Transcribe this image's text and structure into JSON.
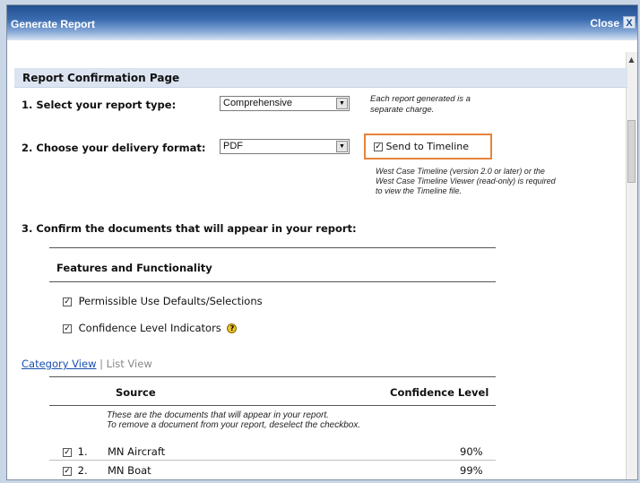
{
  "window": {
    "title": "Generate Report",
    "close_label": "Close",
    "close_icon_glyph": "X"
  },
  "section": {
    "title": "Report Confirmation Page"
  },
  "step1": {
    "label": "1. Select your report type:",
    "selected": "Comprehensive",
    "note_line1": "Each report generated is a",
    "note_line2": "separate charge."
  },
  "step2": {
    "label": "2. Choose your delivery format:",
    "selected": "PDF",
    "timeline_label": "Send to Timeline",
    "timeline_checked": true,
    "note_line1": "West Case Timeline (version 2.0 or later) or the",
    "note_line2": "West Case Timeline Viewer (read-only) is required",
    "note_line3": "to view the Timeline file."
  },
  "step3": {
    "label": "3. Confirm the documents that will appear in your report:"
  },
  "features": {
    "heading": "Features and Functionality",
    "items": [
      {
        "label": "Permissible Use Defaults/Selections",
        "checked": true
      },
      {
        "label": "Confidence Level Indicators",
        "checked": true,
        "help_icon": "help-question-icon"
      }
    ]
  },
  "views": {
    "category": "Category View",
    "separator": "|",
    "list": "List View"
  },
  "table": {
    "col_source": "Source",
    "col_confidence": "Confidence Level",
    "instructions_line1": "These are the documents that will appear in your report.",
    "instructions_line2": "To remove a document from your report, deselect the checkbox.",
    "rows": [
      {
        "num": "1.",
        "source": "MN Aircraft",
        "confidence": "90%",
        "checked": true
      },
      {
        "num": "2.",
        "source": "MN Boat",
        "confidence": "99%",
        "checked": true
      }
    ]
  },
  "colors": {
    "title_bar": "#2a5a9c",
    "section_header_bg": "#dbe4f0",
    "highlight_border": "#e8833a",
    "link": "#1a4fb0"
  }
}
